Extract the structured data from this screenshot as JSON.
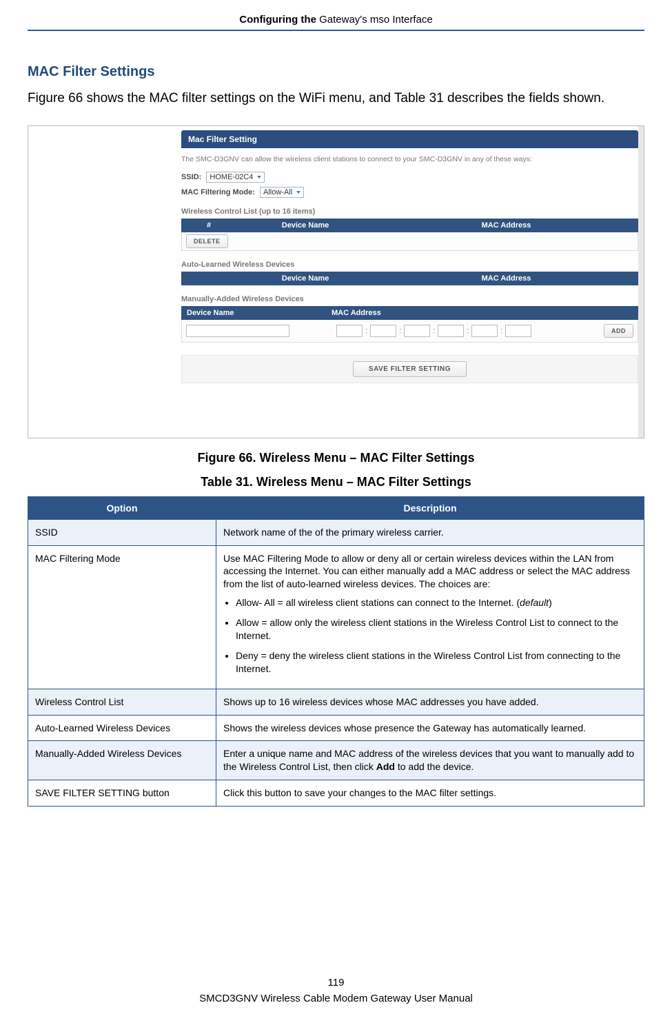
{
  "header": {
    "prefix": "Configuring the ",
    "suffix": "Gateway's mso Interface"
  },
  "section_title": "MAC Filter Settings",
  "intro": "Figure 66 shows the MAC filter settings on the WiFi menu, and Table 31 describes the fields shown.",
  "screenshot": {
    "panel_title": "Mac Filter Setting",
    "panel_descr": "The SMC-D3GNV can allow the wireless client stations to connect to your SMC-D3GNV in any of these ways:",
    "ssid_label": "SSID:",
    "ssid_value": "HOME-02C4",
    "mode_label": "MAC Filtering Mode:",
    "mode_value": "Allow-All",
    "wcl_label": "Wireless Control List (up to 16 items)",
    "wcl_cols": {
      "idx": "#",
      "name": "Device Name",
      "mac": "MAC Address"
    },
    "delete_btn": "DELETE",
    "auto_label": "Auto-Learned Wireless Devices",
    "auto_cols": {
      "name": "Device Name",
      "mac": "MAC Address"
    },
    "manual_label": "Manually-Added Wireless Devices",
    "manual_cols": {
      "name": "Device Name",
      "mac": "MAC Address"
    },
    "add_btn": "ADD",
    "save_btn": "SAVE FILTER SETTING"
  },
  "figure_caption": "Figure 66. Wireless Menu – MAC Filter Settings",
  "table_caption": "Table 31. Wireless Menu – MAC Filter Settings",
  "table_headers": {
    "option": "Option",
    "description": "Description"
  },
  "rows": {
    "ssid": {
      "opt": "SSID",
      "desc": "Network name of the of the primary wireless carrier."
    },
    "mode": {
      "opt": "MAC Filtering Mode",
      "desc_intro": "Use MAC Filtering Mode to allow or deny all or certain wireless devices within the LAN from accessing the Internet. You can either manually add a MAC address or select the MAC address from the list of auto-learned wireless devices. The choices are:",
      "bullet1_a": "Allow- All = all wireless client stations can connect to the Internet. (",
      "bullet1_b": "default",
      "bullet1_c": ")",
      "bullet2": "Allow = allow only the wireless client stations in the Wireless Control List to connect to the Internet.",
      "bullet3": "Deny = deny the wireless client stations in the Wireless Control List from connecting to the Internet."
    },
    "wcl": {
      "opt": "Wireless Control List",
      "desc": "Shows up to 16 wireless devices whose MAC addresses you have added."
    },
    "auto": {
      "opt": "Auto-Learned Wireless Devices",
      "desc": "Shows the wireless devices whose presence the Gateway has automatically learned."
    },
    "manual": {
      "opt": "Manually-Added Wireless Devices",
      "desc_a": "Enter a unique name and MAC address of the wireless devices that you want to manually add to the Wireless Control List, then click ",
      "desc_b": "Add",
      "desc_c": " to add the device."
    },
    "save": {
      "opt": "SAVE FILTER SETTING button",
      "desc": "Click this button to save your changes to the MAC filter settings."
    }
  },
  "footer": {
    "page_num": "119",
    "product": "SMCD3GNV Wireless Cable Modem Gateway User Manual"
  }
}
